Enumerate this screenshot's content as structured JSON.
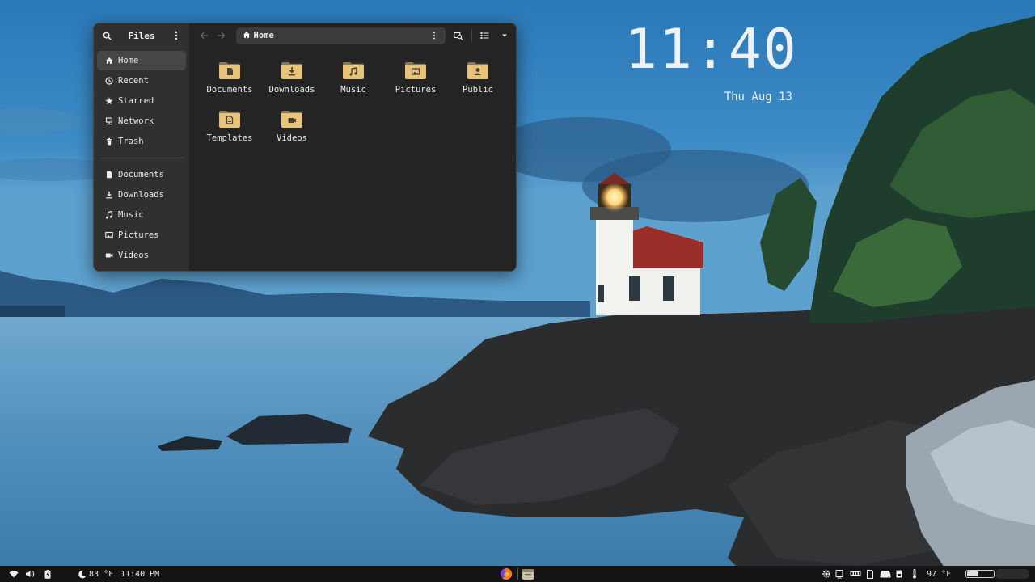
{
  "desktop": {
    "time": "11:40",
    "date": "Thu Aug 13"
  },
  "window": {
    "title": "Files",
    "path_label": "Home",
    "sidebar": {
      "places": [
        {
          "label": "Home",
          "icon": "home-icon",
          "active": true
        },
        {
          "label": "Recent",
          "icon": "clock-icon",
          "active": false
        },
        {
          "label": "Starred",
          "icon": "star-icon",
          "active": false
        },
        {
          "label": "Network",
          "icon": "network-icon",
          "active": false
        },
        {
          "label": "Trash",
          "icon": "trash-icon",
          "active": false
        }
      ],
      "bookmarks": [
        {
          "label": "Documents",
          "icon": "document-icon"
        },
        {
          "label": "Downloads",
          "icon": "download-icon"
        },
        {
          "label": "Music",
          "icon": "music-icon"
        },
        {
          "label": "Pictures",
          "icon": "picture-icon"
        },
        {
          "label": "Videos",
          "icon": "video-icon"
        }
      ]
    },
    "folders": [
      {
        "label": "Documents",
        "icon": "folder-documents-icon"
      },
      {
        "label": "Downloads",
        "icon": "folder-downloads-icon"
      },
      {
        "label": "Music",
        "icon": "folder-music-icon"
      },
      {
        "label": "Pictures",
        "icon": "folder-pictures-icon"
      },
      {
        "label": "Public",
        "icon": "folder-public-icon"
      },
      {
        "label": "Templates",
        "icon": "folder-templates-icon"
      },
      {
        "label": "Videos",
        "icon": "folder-videos-icon"
      }
    ]
  },
  "taskbar": {
    "weather_left": "83 °F",
    "clock": "11:40 PM",
    "temperature_right": "97 °F",
    "battery_level": 0.45
  },
  "colors": {
    "folder": "#e8c47a",
    "folder_tab": "#d3aa5c",
    "window_bg": "#242424",
    "sidebar_bg": "#303030",
    "taskbar_bg": "#141414"
  }
}
